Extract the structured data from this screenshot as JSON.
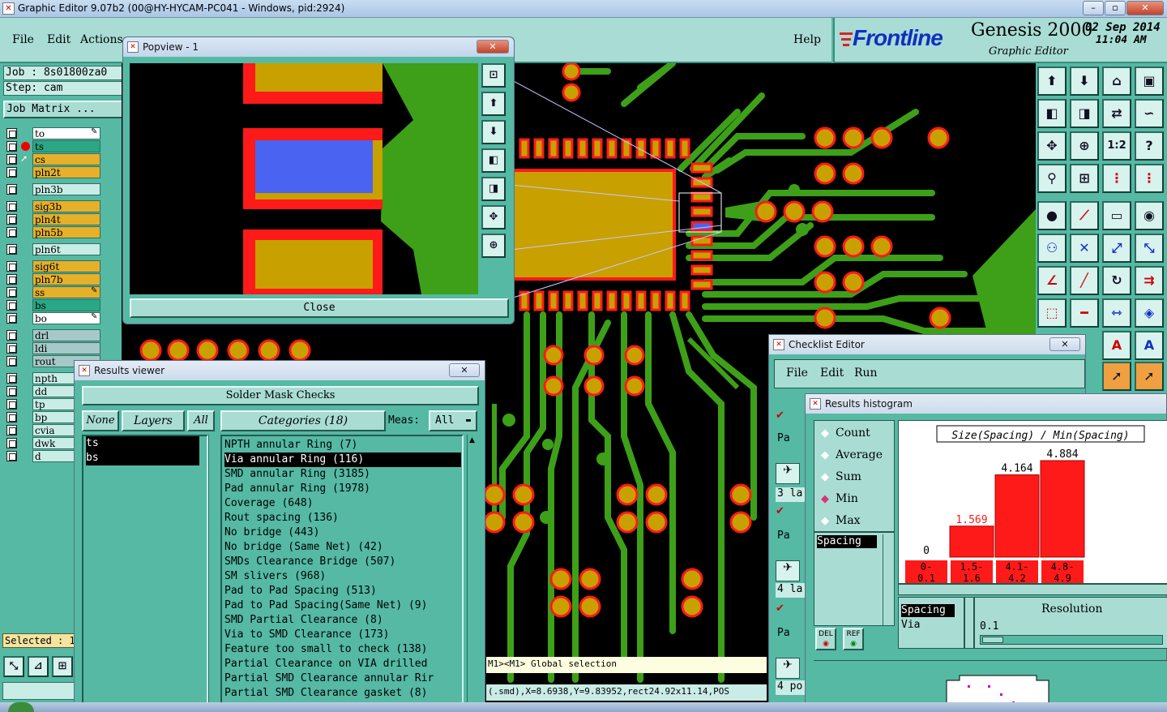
{
  "window": {
    "title": "Graphic Editor 9.07b2 (00@HY-HYCAM-PC041 - Windows, pid:2924)"
  },
  "menu": {
    "file": "File",
    "edit": "Edit",
    "actions": "Actions",
    "help": "Help"
  },
  "brand": {
    "logo": "Frontline",
    "product": "Genesis 2000",
    "subtitle": "Graphic Editor",
    "date": "02  Sep 2014",
    "time": "11:04 AM"
  },
  "left": {
    "job": "Job : 8s01800za0",
    "step": "Step: cam",
    "job_matrix": "Job Matrix ...",
    "selected": "Selected : 1",
    "layers": [
      {
        "name": "to",
        "color": "#ffffff",
        "mark": "pen"
      },
      {
        "name": "ts",
        "color": "#2aa885",
        "mark": "dot"
      },
      {
        "name": "cs",
        "color": "#e6b02a",
        "mark": "arrow"
      },
      {
        "name": "pln2t",
        "color": "#e6b02a",
        "mark": ""
      },
      {
        "name": "pln3b",
        "color": "#c9ece6",
        "mark": ""
      },
      {
        "name": "sig3b",
        "color": "#e6b02a",
        "mark": ""
      },
      {
        "name": "pln4t",
        "color": "#e6b02a",
        "mark": ""
      },
      {
        "name": "pln5b",
        "color": "#e6b02a",
        "mark": ""
      },
      {
        "name": "pln6t",
        "color": "#c9ece6",
        "mark": ""
      },
      {
        "name": "sig6t",
        "color": "#e6b02a",
        "mark": ""
      },
      {
        "name": "pln7b",
        "color": "#e6b02a",
        "mark": ""
      },
      {
        "name": "ss",
        "color": "#e6b02a",
        "mark": "pen"
      },
      {
        "name": "bs",
        "color": "#2aa885",
        "mark": ""
      },
      {
        "name": "bo",
        "color": "#ffffff",
        "mark": "pen"
      },
      {
        "name": "drl",
        "color": "#a6c8c8",
        "mark": ""
      },
      {
        "name": "ldi",
        "color": "#a6c8c8",
        "mark": ""
      },
      {
        "name": "rout",
        "color": "#a6c8c8",
        "mark": ""
      },
      {
        "name": "npth",
        "color": "#c9ece6",
        "mark": ""
      },
      {
        "name": "dd",
        "color": "#c9ece6",
        "mark": ""
      },
      {
        "name": "tp",
        "color": "#c9ece6",
        "mark": ""
      },
      {
        "name": "bp",
        "color": "#c9ece6",
        "mark": ""
      },
      {
        "name": "cvia",
        "color": "#c9ece6",
        "mark": ""
      },
      {
        "name": "dwk",
        "color": "#c9ece6",
        "mark": ""
      },
      {
        "name": "d",
        "color": "#c9ece6",
        "mark": ""
      }
    ]
  },
  "popview": {
    "title": "Popview - 1",
    "close": "Close",
    "close_icon": "✕"
  },
  "results_viewer": {
    "title": "Results viewer",
    "header": "Solder Mask Checks",
    "none": "None",
    "layers": "Layers",
    "all": "All",
    "categories": "Categories (18)",
    "meas_label": "Meas:",
    "meas_value": "All",
    "layer_items": [
      "ts",
      "bs"
    ],
    "category_items": [
      "NPTH annular Ring (7)",
      "Via annular Ring (116)",
      "SMD annular Ring (3185)",
      "Pad annular Ring (1978)",
      "Coverage (648)",
      "Rout spacing (136)",
      "No bridge (443)",
      "No bridge (Same Net) (42)",
      "SMDs Clearance Bridge (507)",
      "SM slivers (968)",
      "Pad to Pad Spacing (513)",
      "Pad to Pad Spacing(Same Net) (9)",
      "SMD Partial Clearance (8)",
      "Via to SMD Clearance (173)",
      "Feature too small to check (138)",
      "Partial Clearance on VIA drilled",
      "Partial SMD Clearance annular Rir",
      "Partial SMD Clearance gasket (8)"
    ]
  },
  "status": {
    "line1": "M1><M1> Global selection",
    "line2": "(.smd),X=8.6938,Y=9.83952,rect24.92x11.14,POS"
  },
  "checklist": {
    "title": "Checklist Editor",
    "file": "File",
    "edit": "Edit",
    "run": "Run",
    "labels": [
      "Pa",
      "3 la",
      "Pa",
      "4 la",
      "Pa",
      "4 po"
    ]
  },
  "histogram": {
    "title": "Results histogram",
    "options": [
      "Count",
      "Average",
      "Sum",
      "Min",
      "Max"
    ],
    "selected_option": "Min",
    "chart_title": "Size(Spacing) / Min(Spacing)",
    "field_list": [
      "Spacing"
    ],
    "del": "DEL",
    "ref": "REF",
    "bottom_list": [
      "Spacing",
      "Via"
    ],
    "resolution_label": "Resolution",
    "resolution_value": "0.1"
  },
  "chart_data": {
    "type": "bar",
    "title": "Size(Spacing) / Min(Spacing)",
    "categories": [
      "0-\n0.1",
      "1.5-\n1.6",
      "4.1-\n4.2",
      "4.8-\n4.9"
    ],
    "values": [
      0,
      1.569,
      4.164,
      4.884
    ],
    "value_labels": [
      "0",
      "1.569",
      "4.164",
      "4.884"
    ],
    "ylim": [
      0,
      5.5
    ],
    "colors": {
      "bar": "#ff1a1a",
      "first_label": "#ff1a1a"
    }
  },
  "colors": {
    "teal_bg": "#55b9a4",
    "copper": "#c8a000",
    "trace_green": "#3da018",
    "pad_red": "#ff1a1a",
    "highlight_blue": "#4a63f0"
  }
}
